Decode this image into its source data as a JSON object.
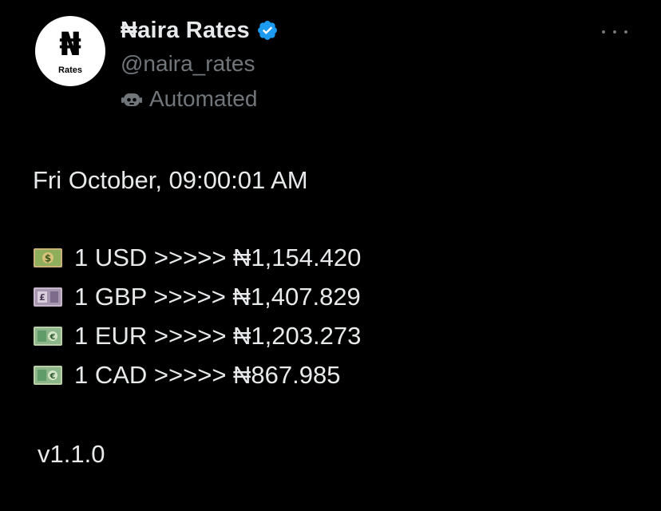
{
  "account": {
    "avatar_glyph": "₦",
    "avatar_caption": "Rates",
    "display_name": "₦aira Rates",
    "handle": "@naira_rates",
    "automated_label": "Automated"
  },
  "post": {
    "timestamp": "Fri October, 09:00:01 AM",
    "rates": [
      {
        "icon": "dollar-banknote-icon",
        "text": "1 USD >>>>> ₦1,154.420"
      },
      {
        "icon": "pound-banknote-icon",
        "text": "1 GBP >>>>> ₦1,407.829"
      },
      {
        "icon": "euro-banknote-icon",
        "text": "1 EUR >>>>> ₦1,203.273"
      },
      {
        "icon": "euro-banknote-icon",
        "text": "1 CAD >>>>> ₦867.985"
      }
    ],
    "version": "v1.1.0"
  },
  "colors": {
    "background": "#000000",
    "text_primary": "#e7e9ea",
    "text_secondary": "#71767b",
    "verified_blue": "#1d9bf0"
  }
}
